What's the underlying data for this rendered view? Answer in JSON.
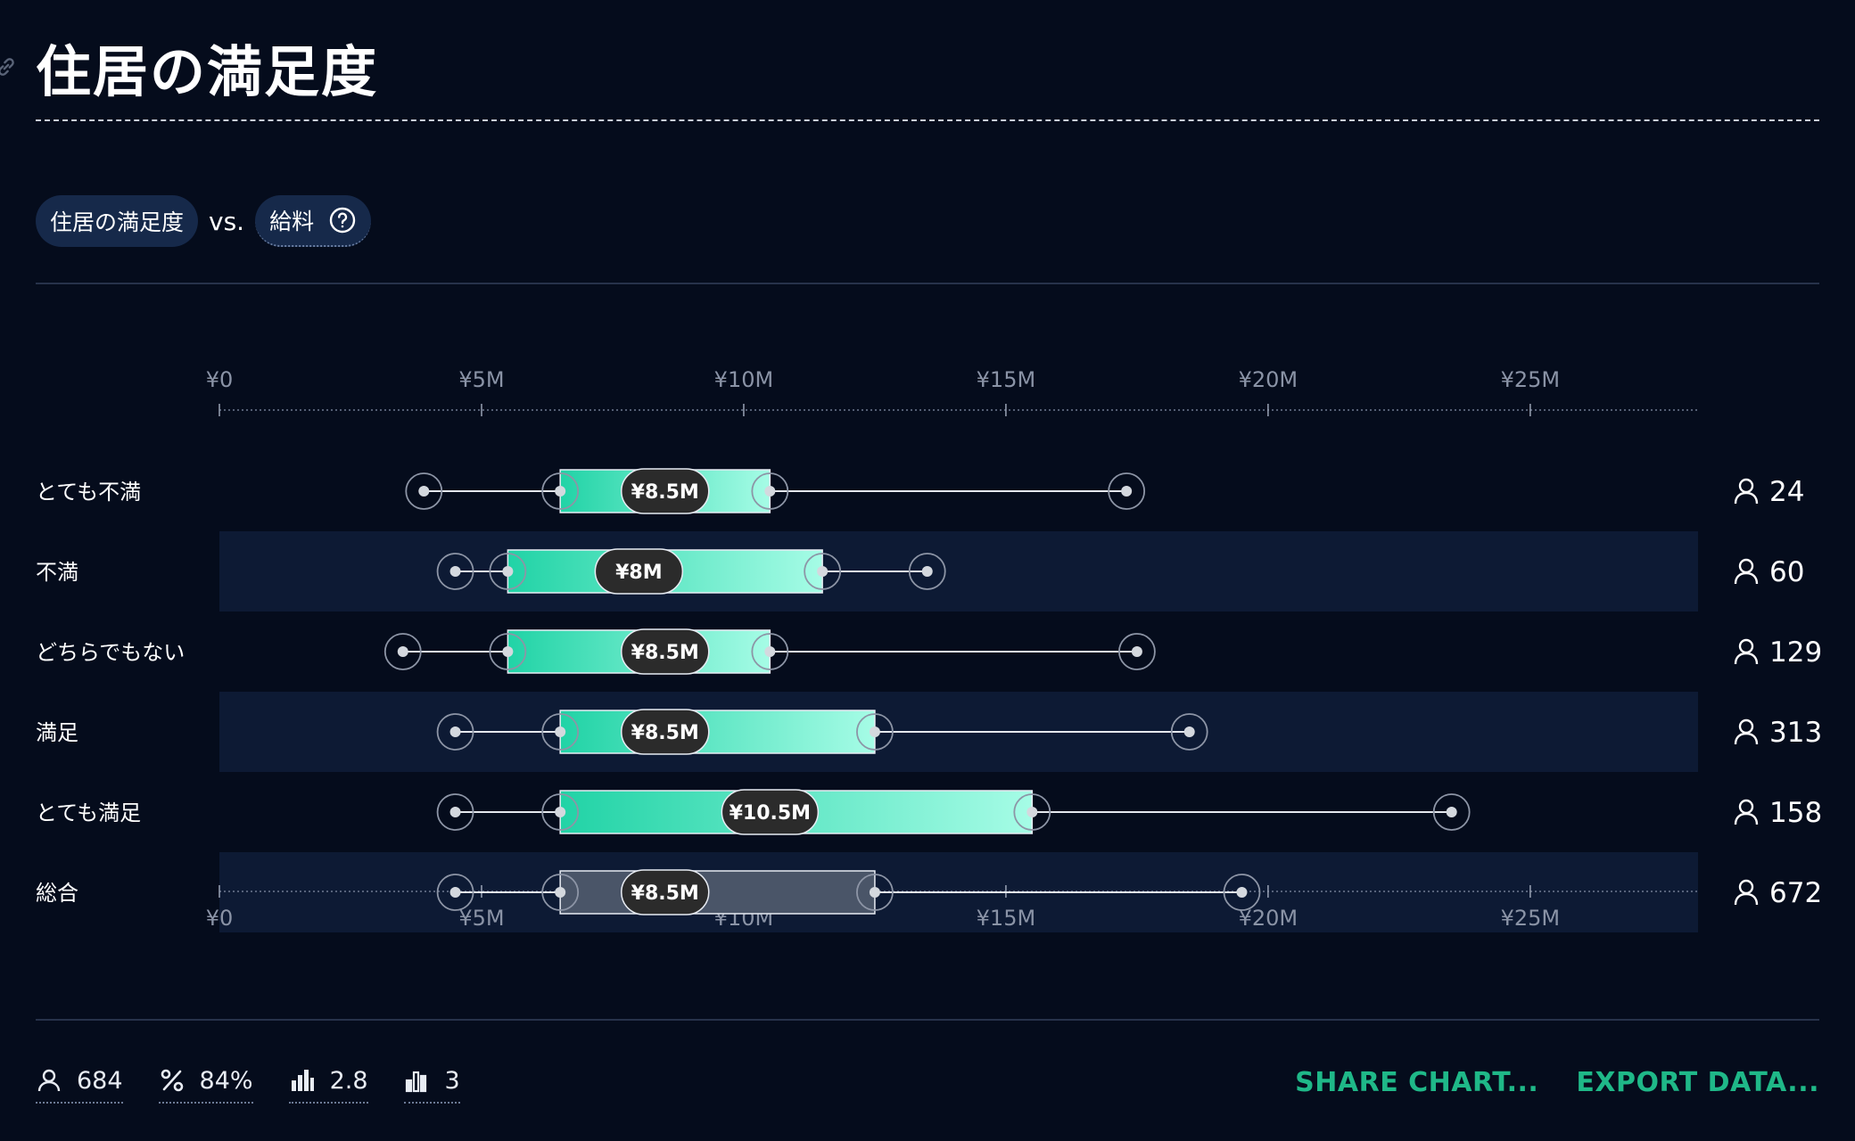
{
  "title": "住居の満足度",
  "controls": {
    "primary_variable": "住居の満足度",
    "vs_label": "vs.",
    "secondary_variable": "給料"
  },
  "chart_data": {
    "type": "box",
    "orientation": "horizontal",
    "x_ticks": [
      "¥0",
      "¥5M",
      "¥10M",
      "¥15M",
      "¥20M",
      "¥25M"
    ],
    "x_tick_values": [
      0,
      5,
      10,
      15,
      20,
      25
    ],
    "xlim": [
      0,
      28.2
    ],
    "x_unit": "¥M",
    "axis_position": "top-and-bottom",
    "series": [
      {
        "category": "とても不満",
        "min": 3.9,
        "q1": 6.5,
        "median": 8.5,
        "q3": 10.5,
        "max": 17.3,
        "median_label": "¥8.5M",
        "count": 24
      },
      {
        "category": "不満",
        "min": 4.5,
        "q1": 5.5,
        "median": 8.0,
        "q3": 11.5,
        "max": 13.5,
        "median_label": "¥8M",
        "count": 60
      },
      {
        "category": "どちらでもない",
        "min": 3.5,
        "q1": 5.5,
        "median": 8.5,
        "q3": 10.5,
        "max": 17.5,
        "median_label": "¥8.5M",
        "count": 129
      },
      {
        "category": "満足",
        "min": 4.5,
        "q1": 6.5,
        "median": 8.5,
        "q3": 12.5,
        "max": 18.5,
        "median_label": "¥8.5M",
        "count": 313
      },
      {
        "category": "とても満足",
        "min": 4.5,
        "q1": 6.5,
        "median": 10.5,
        "q3": 15.5,
        "max": 23.5,
        "median_label": "¥10.5M",
        "count": 158
      },
      {
        "category": "総合",
        "min": 4.5,
        "q1": 6.5,
        "median": 8.5,
        "q3": 12.5,
        "max": 19.5,
        "median_label": "¥8.5M",
        "count": 672,
        "overall": true
      }
    ]
  },
  "colors": {
    "background": "#050c1c",
    "stripe": "#0d1a34",
    "box_start": "#21d3a6",
    "box_end": "#a6fce6",
    "overall_box": "#4a5568",
    "accent": "#1fb888"
  },
  "footer": {
    "stats": [
      {
        "icon": "person-icon",
        "value": "684"
      },
      {
        "icon": "percent-icon",
        "value": "84%"
      },
      {
        "icon": "bar-chart-icon",
        "value": "2.8"
      },
      {
        "icon": "bar-chart-outline-icon",
        "value": "3"
      }
    ],
    "share_label": "SHARE CHART...",
    "export_label": "EXPORT DATA..."
  }
}
